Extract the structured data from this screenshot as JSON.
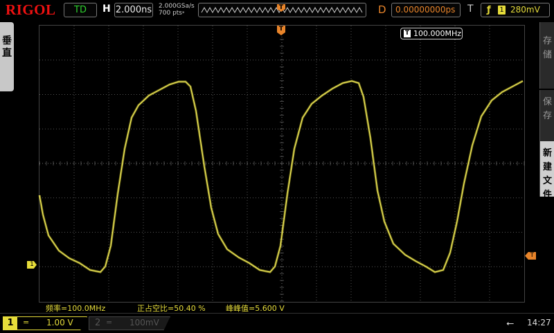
{
  "brand": "RIGOL",
  "header": {
    "mode": "TD",
    "h_label": "H",
    "timebase": "2.000ns",
    "sample_rate": "2.000GSa/s",
    "memory_depth": "700",
    "memory_unit": "pts",
    "delay_label": "D",
    "delay": "0.00000000ps",
    "trigger_label": "T",
    "trigger_source": "1",
    "trigger_level": "280mV",
    "trigger_edge_icon": "rising-edge-icon"
  },
  "left_panel": {
    "label_line1": "垂",
    "label_line2": "直"
  },
  "right_panel": {
    "buttons": [
      {
        "line1": "存",
        "line2": "储",
        "line3": ""
      },
      {
        "line1": "保",
        "line2": "存",
        "line3": ""
      },
      {
        "line1": "新",
        "line2": "建",
        "line3": "文件"
      }
    ]
  },
  "markers": {
    "trigger_pos": "T",
    "channel1": "1",
    "trigger_level": "T"
  },
  "frequency_counter": {
    "channel": "T",
    "value": "100.000MHz"
  },
  "measurements": {
    "frequency": "频率=100.0MHz",
    "duty_cycle": "正占空比=50.40 %",
    "peak_to_peak": "峰峰值=5.600 V"
  },
  "channels": [
    {
      "num": "1",
      "coupling": "=",
      "scale": "1.00 V",
      "color": "#e6dc3a",
      "active": true
    },
    {
      "num": "2",
      "coupling": "=",
      "scale": "100mV",
      "color": "#555555",
      "active": false
    }
  ],
  "status": {
    "usb_icon": "usb-icon",
    "time": "14:27"
  },
  "colors": {
    "ch1": "#e6dc3a",
    "trigger": "#e8842a",
    "grid": "#6a6a6a"
  }
}
